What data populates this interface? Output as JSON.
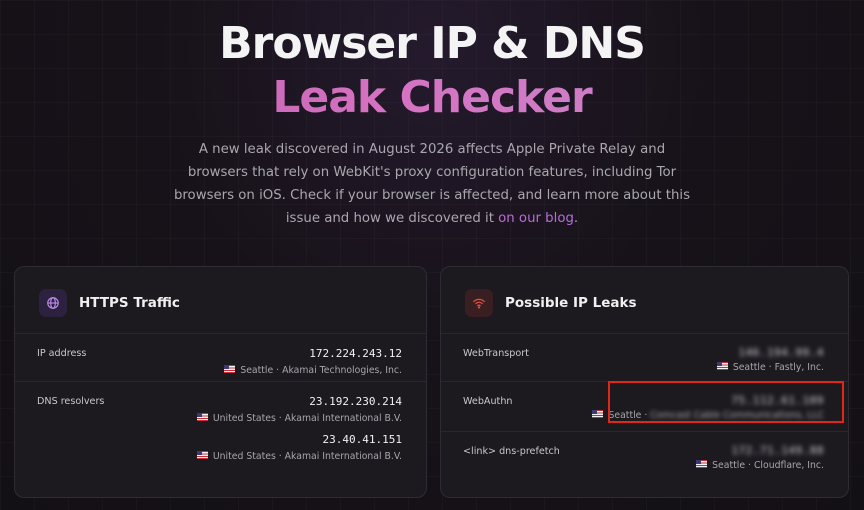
{
  "hero": {
    "title_line1": "Browser IP & DNS",
    "title_line2": "Leak Checker",
    "description": "A new leak discovered in August 2026 affects Apple Private Relay and browsers that rely on WebKit's proxy configuration features, including Tor browsers on iOS. Check if your browser is affected, and learn more about this issue and how we discovered it ",
    "blog_link": "on our blog",
    "trailing": "."
  },
  "https_traffic": {
    "title": "HTTPS Traffic",
    "icon": "globe-icon",
    "rows": [
      {
        "label": "IP address",
        "entries": [
          {
            "ip": "172.224.243.12",
            "meta": "Seattle · Akamai Technologies, Inc."
          }
        ]
      },
      {
        "label": "DNS resolvers",
        "entries": [
          {
            "ip": "23.192.230.214",
            "meta": "United States · Akamai International B.V."
          },
          {
            "ip": "23.40.41.151",
            "meta": "United States · Akamai International B.V."
          }
        ]
      }
    ]
  },
  "ip_leaks": {
    "title": "Possible IP Leaks",
    "icon": "wifi-icon",
    "rows": [
      {
        "label": "WebTransport",
        "ip_redacted": "146.194.99.4",
        "city": "Seattle",
        "org": "Fastly, Inc.",
        "org_redacted": false
      },
      {
        "label": "WebAuthn",
        "ip_redacted": "75.112.61.109",
        "city": "Seattle",
        "org": "Comcast Cable Communications, LLC",
        "org_redacted": true
      },
      {
        "label": "<link> dns-prefetch",
        "ip_redacted": "172.71.149.88",
        "city": "Seattle",
        "org": "Cloudflare, Inc.",
        "org_redacted": false
      }
    ]
  },
  "colors": {
    "accent_purple": "#b96dd8",
    "highlight_red": "#e2271a",
    "card_bg": "#1c1a1f"
  }
}
